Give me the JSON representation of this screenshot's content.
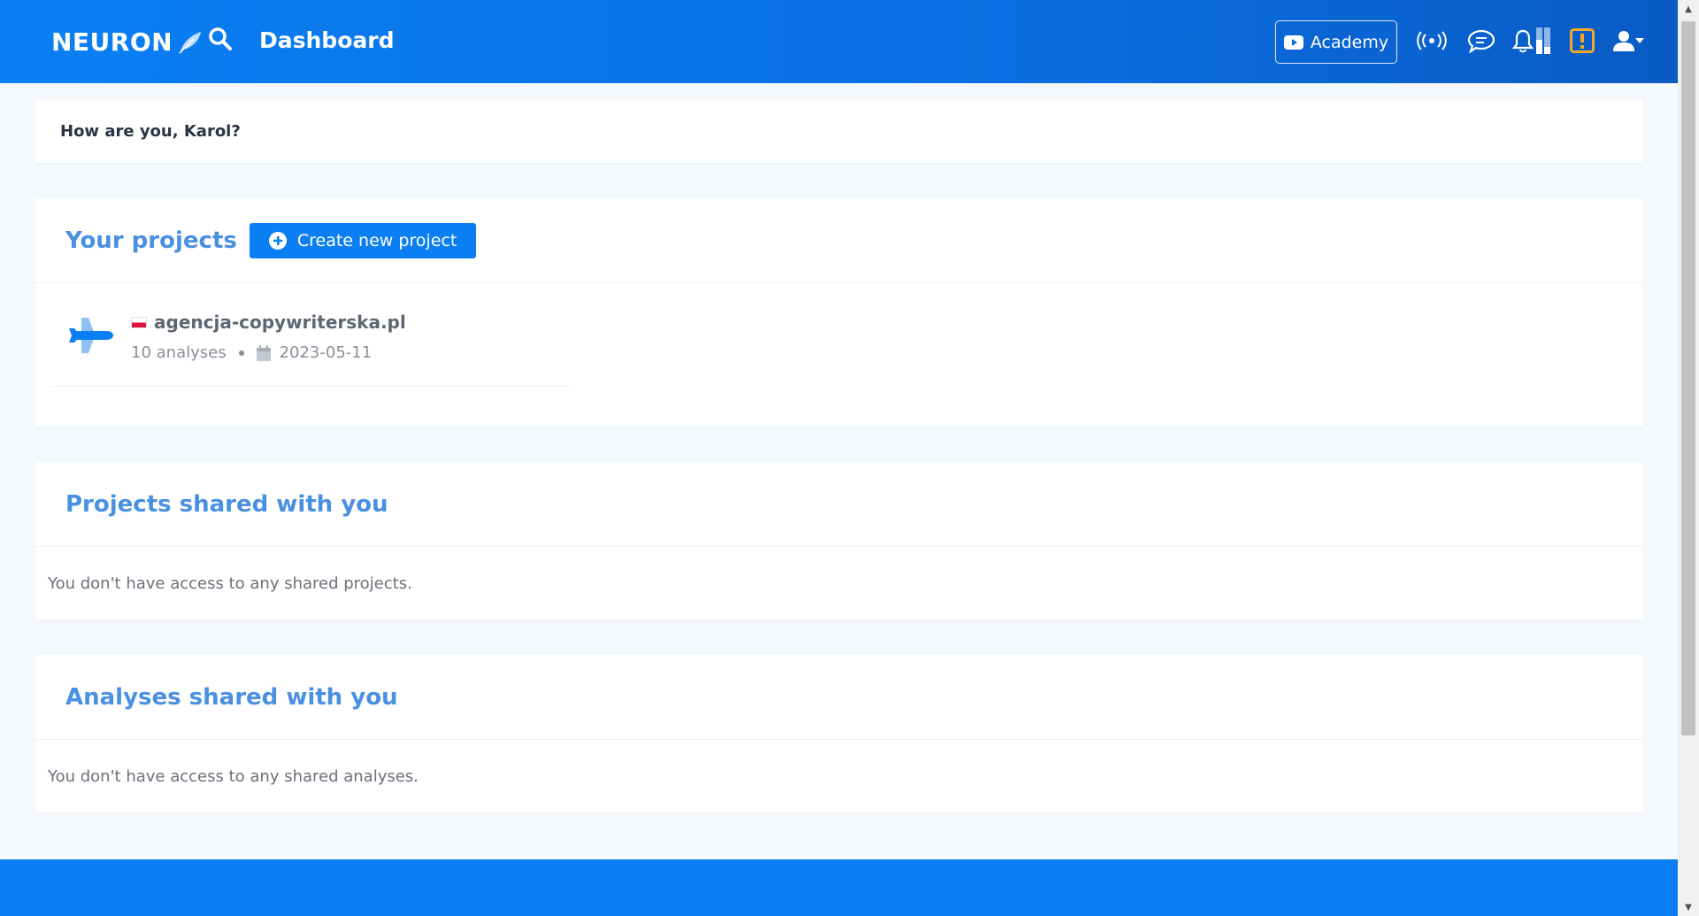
{
  "header": {
    "logo_text": "NEURON",
    "page_title": "Dashboard",
    "academy_label": "Academy",
    "icons": [
      "search-icon",
      "youtube-icon",
      "broadcast-icon",
      "chat-icon",
      "bell-icon",
      "bars-icon",
      "alert-icon",
      "user-icon"
    ]
  },
  "greeting": "How are you, Karol?",
  "projects": {
    "title": "Your projects",
    "create_label": "Create new project",
    "items": [
      {
        "name": "agencja-copywriterska.pl",
        "analyses": "10 analyses",
        "date": "2023-05-11",
        "flag": "PL"
      }
    ]
  },
  "shared_projects": {
    "title": "Projects shared with you",
    "empty": "You don't have access to any shared projects."
  },
  "shared_analyses": {
    "title": "Analyses shared with you",
    "empty": "You don't have access to any shared analyses."
  },
  "colors": {
    "brand_blue": "#0a7ff4",
    "title_blue": "#4a90e2",
    "alert_orange": "#f5a623"
  }
}
